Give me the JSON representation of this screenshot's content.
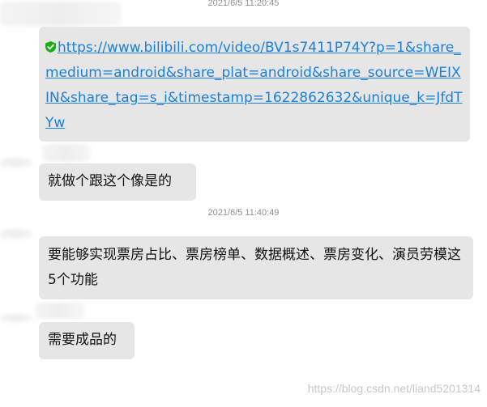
{
  "messages": {
    "time1": "2021/6/5 11:20:45",
    "link": "https://www.bilibili.com/video/BV1s7411P74Y?p=1&share_medium=android&share_plat=android&share_source=WEIXIN&share_tag=s_i&timestamp=1622862632&unique_k=JfdTYw",
    "msg2": "就做个跟这个像是的",
    "time2": "2021/6/5 11:40:49",
    "msg3": "要能够实现票房占比、票房榜单、数据概述、票房变化、演员劳模这5个功能",
    "msg4": "需要成品的"
  },
  "watermark": "https://blog.csdn.net/liand5201314",
  "colors": {
    "bubble": "#e6e6e6",
    "link": "#1a80d9",
    "timestamp": "#8e8e8e",
    "shield": "#1aad19"
  },
  "icons": {
    "security": "shield-check-icon"
  }
}
